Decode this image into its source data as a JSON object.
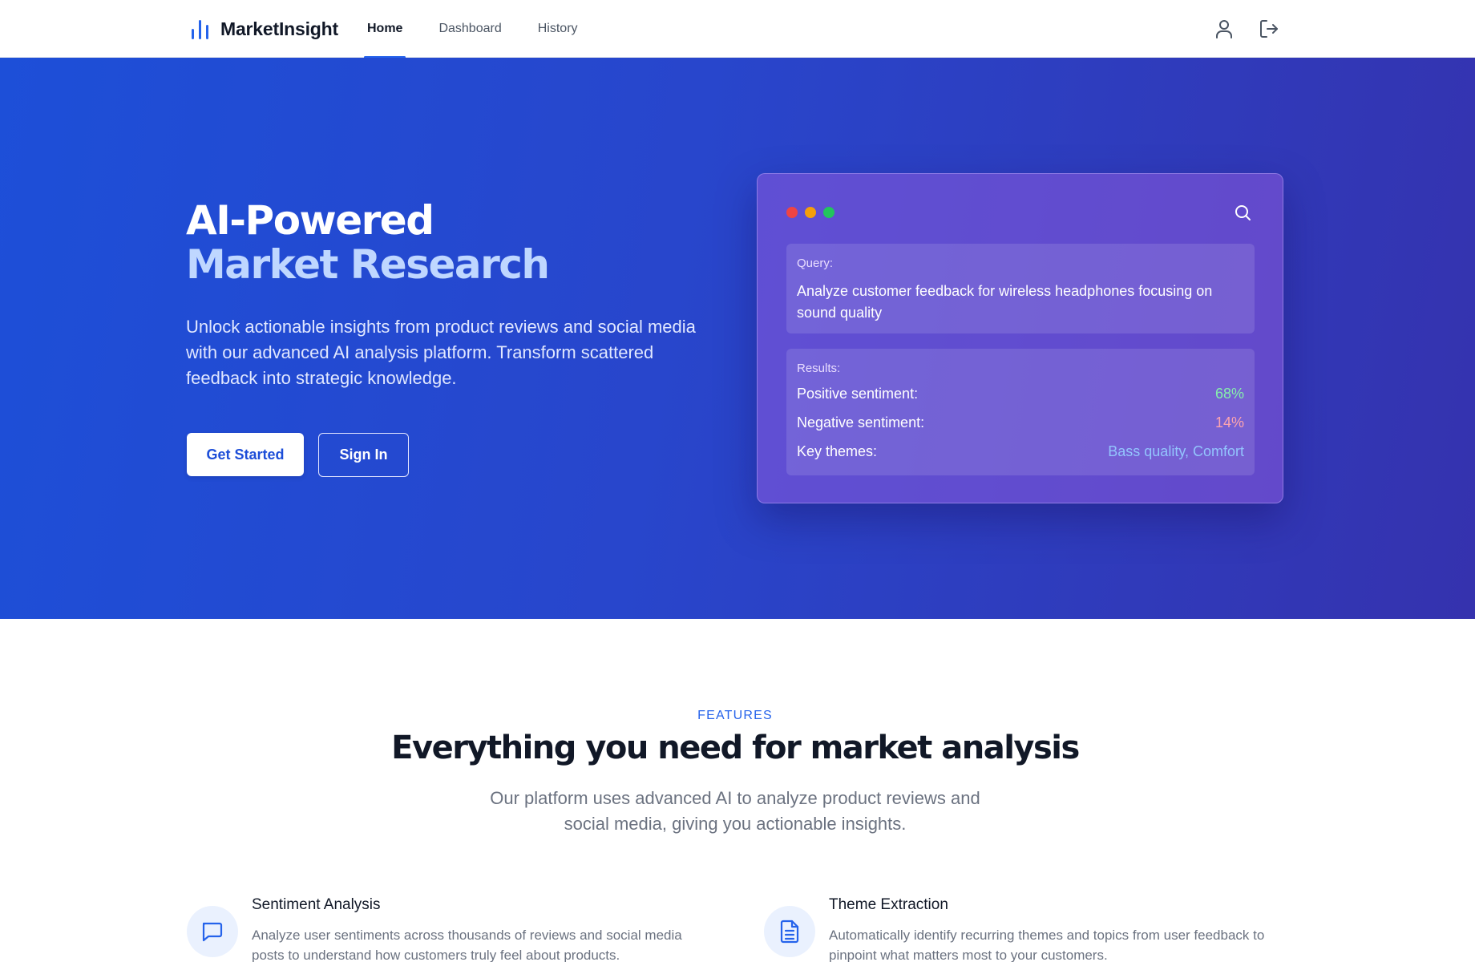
{
  "brand": {
    "name": "MarketInsight",
    "logo_icon": "bar-chart-icon",
    "accent": "#2563eb"
  },
  "nav": {
    "links": [
      {
        "label": "Home",
        "active": true
      },
      {
        "label": "Dashboard",
        "active": false
      },
      {
        "label": "History",
        "active": false
      }
    ],
    "icons": [
      "user-icon",
      "logout-icon"
    ]
  },
  "hero": {
    "title_line1": "AI-Powered",
    "title_line2": "Market Research",
    "description": "Unlock actionable insights from product reviews and social media with our advanced AI analysis platform. Transform scattered feedback into strategic knowledge.",
    "primary_button": "Get Started",
    "secondary_button": "Sign In",
    "gradient": [
      "#1d4fd8",
      "#3532ae"
    ]
  },
  "preview": {
    "window_dots": [
      "#ef4444",
      "#f59e0b",
      "#22c55e"
    ],
    "search_icon": "search-icon",
    "query_label": "Query:",
    "query_text": "Analyze customer feedback for wireless headphones focusing on sound quality",
    "results_label": "Results:",
    "results": [
      {
        "key": "Positive sentiment:",
        "value": "68%"
      },
      {
        "key": "Negative sentiment:",
        "value": "14%"
      },
      {
        "key": "Key themes:",
        "value": "Bass quality, Comfort"
      }
    ]
  },
  "features": {
    "eyebrow": "FEATURES",
    "title": "Everything you need for market analysis",
    "subtitle": "Our platform uses advanced AI to analyze product reviews and social media, giving you actionable insights.",
    "items": [
      {
        "icon": "chat-bubble-icon",
        "title": "Sentiment Analysis",
        "description": "Analyze user sentiments across thousands of reviews and social media posts to understand how customers truly feel about products."
      },
      {
        "icon": "document-icon",
        "title": "Theme Extraction",
        "description": "Automatically identify recurring themes and topics from user feedback to pinpoint what matters most to your customers."
      }
    ]
  }
}
